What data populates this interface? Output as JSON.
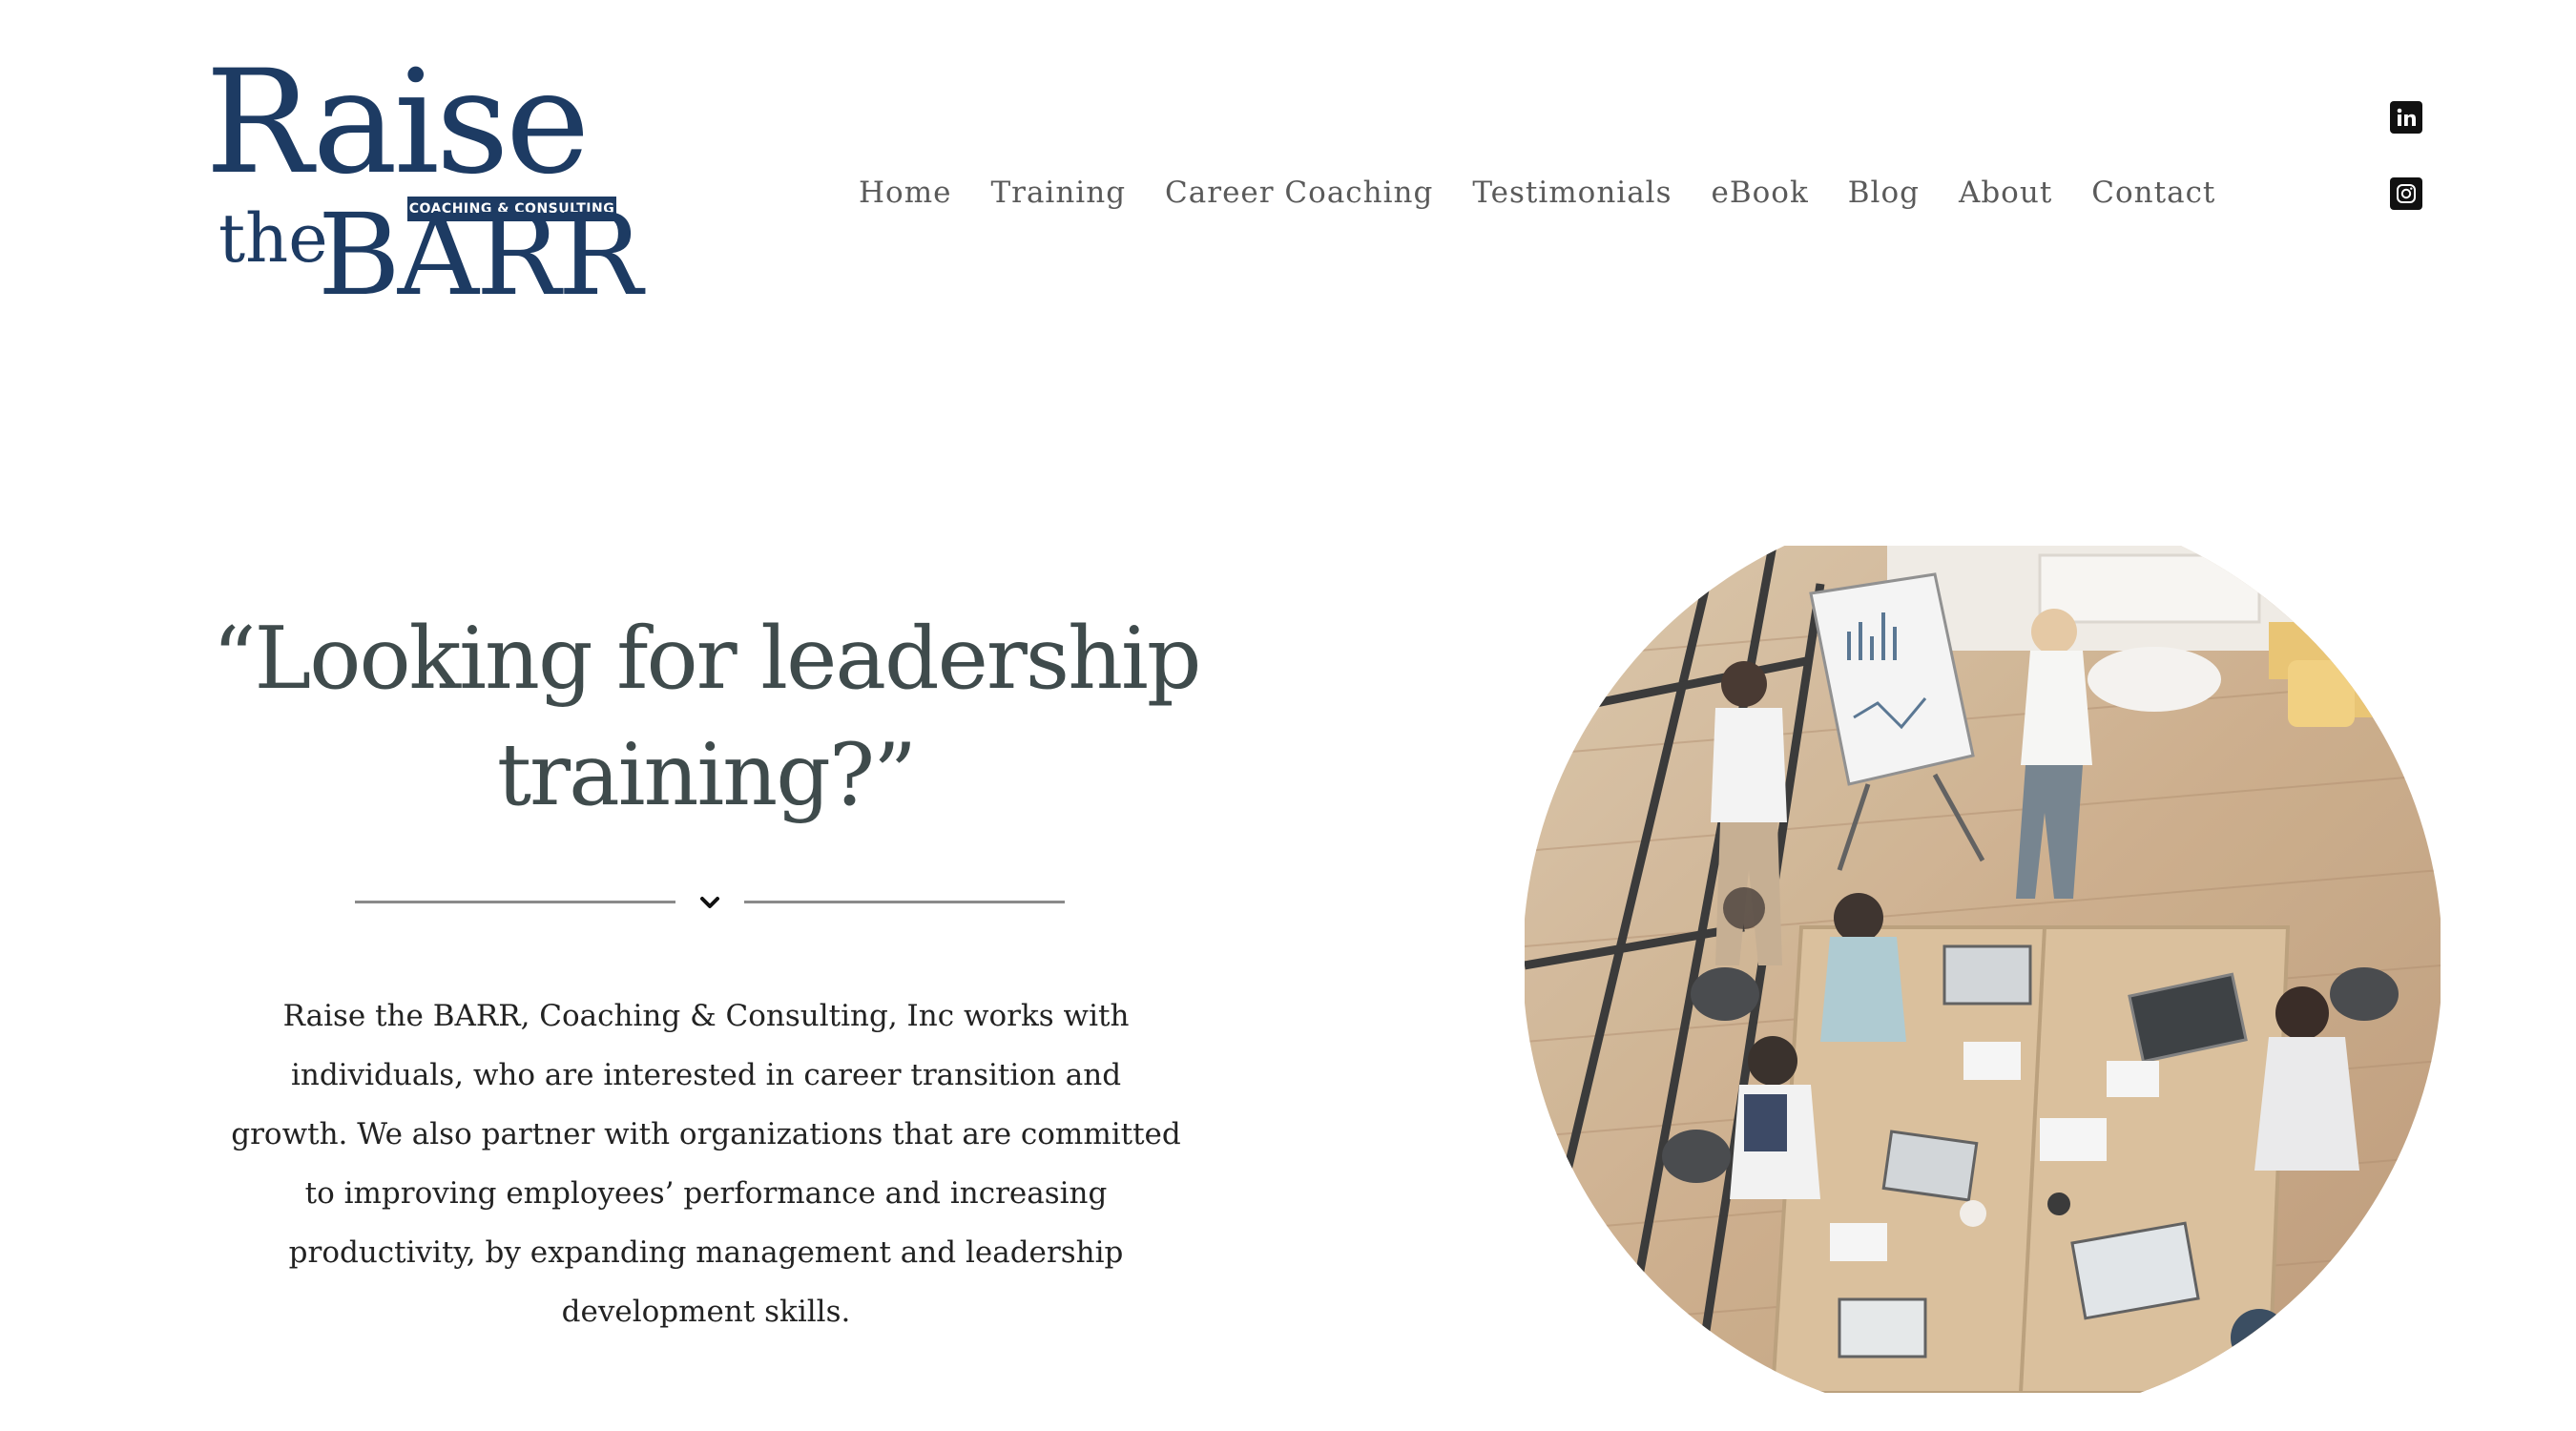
{
  "brand": {
    "logo_word_top": "Raise",
    "logo_word_small": "the",
    "logo_word_bottom": "BARR",
    "logo_tagline": "COACHING & CONSULTING",
    "color": "#1d3b63"
  },
  "nav": {
    "items": [
      {
        "label": "Home"
      },
      {
        "label": "Training"
      },
      {
        "label": "Career Coaching"
      },
      {
        "label": "Testimonials"
      },
      {
        "label": "eBook"
      },
      {
        "label": "Blog"
      },
      {
        "label": "About"
      },
      {
        "label": "Contact"
      }
    ]
  },
  "social": {
    "icons": [
      "linkedin-icon",
      "instagram-icon"
    ]
  },
  "hero": {
    "headline_line1": "“Looking for leadership",
    "headline_line2": "training?”",
    "divider_icon": "chevron-down-icon",
    "intro_text": "Raise the BARR, Coaching & Consulting, Inc works with individuals, who are interested in career transition and growth. We also partner with organizations that are committed to improving employees’ performance and increasing productivity, by expanding management and leadership development skills.",
    "image_alt": "team-meeting-photo"
  },
  "colors": {
    "headline": "#3f4b4c",
    "nav_text": "#5a5a5a",
    "body_text": "#222222",
    "divider": "#8a8a8a"
  }
}
